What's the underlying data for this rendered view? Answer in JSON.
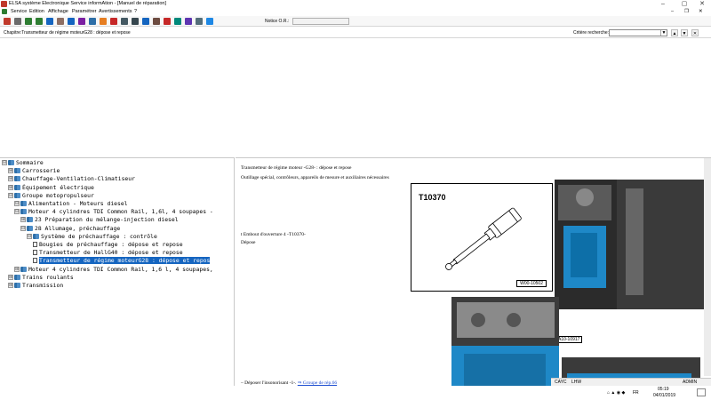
{
  "window": {
    "title": "ELSA système Electronique Service informAtion - [Manuel de réparation]",
    "minimize": "–",
    "maximize": "▢",
    "close": "✕"
  },
  "menu": {
    "items": [
      "Service",
      "Edition",
      "Affichage",
      "Paramétrer",
      "Avertissements",
      "?"
    ],
    "doc_minimize": "–",
    "doc_maximize": "❐",
    "doc_close": "✕"
  },
  "toolbar": {
    "notice_label": "Notice O.R.:",
    "notice_value": "",
    "icons": [
      "open-icon",
      "print-icon",
      "back-icon",
      "forward-icon",
      "tree-icon",
      "history-icon",
      "info-icon",
      "home-icon",
      "book-icon",
      "wiring-icon",
      "stop-icon",
      "tool-icon",
      "battery-icon",
      "save-icon",
      "catalog-icon",
      "car-icon",
      "note-icon",
      "mail-icon",
      "zoom-icon",
      "help-icon"
    ],
    "colors": {
      "open-icon": "#c0392b",
      "print-icon": "#6b6b6b",
      "back-icon": "#2e7d32",
      "forward-icon": "#2e7d32",
      "tree-icon": "#1565c0",
      "history-icon": "#8d6e63",
      "info-icon": "#1565c0",
      "home-icon": "#7b1fa2",
      "book-icon": "#2e6fa8",
      "wiring-icon": "#e67e22",
      "stop-icon": "#c62828",
      "tool-icon": "#455a64",
      "battery-icon": "#37474f",
      "save-icon": "#1565c0",
      "catalog-icon": "#6d4c41",
      "car-icon": "#c62828",
      "note-icon": "#00897b",
      "mail-icon": "#5e35b1",
      "zoom-icon": "#546e7a",
      "help-icon": "#1e88e5"
    }
  },
  "chapter_bar": {
    "chapter": "Chapitre:Transmetteur de régime moteurG28 : dépose et repose",
    "critere_label": "Critère recherche:",
    "critere_value": "",
    "dropdown_arrow": "▼",
    "btn_up": "▲",
    "btn_down": "▼",
    "btn_x": "✕"
  },
  "tree": {
    "nodes": [
      {
        "exp": "⊟",
        "icon": "book",
        "label": "Sommaire"
      },
      {
        "exp": "⊞",
        "icon": "book",
        "label": "Carrosserie"
      },
      {
        "exp": "⊞",
        "icon": "book",
        "label": "Chauffage-Ventilation-Climatiseur"
      },
      {
        "exp": "⊞",
        "icon": "book",
        "label": "Équipement électrique"
      },
      {
        "exp": "⊟",
        "icon": "book",
        "label": "Groupe motopropulseur"
      },
      {
        "exp": "⊟",
        "icon": "book",
        "label": "Alimentation - Moteurs diesel"
      },
      {
        "exp": "⊟",
        "icon": "book",
        "label": "Moteur 4 cylindres TDI Common Rail, 1,6l, 4 soupapes -"
      },
      {
        "exp": "⊞",
        "icon": "book",
        "label": "23 Préparation du mélange-injection diesel"
      },
      {
        "exp": "⊟",
        "icon": "book",
        "label": "28 Allumage, préchauffage"
      },
      {
        "exp": "⊟",
        "icon": "book",
        "label": "Système de préchauffage : contrôle"
      },
      {
        "exp": "",
        "icon": "page",
        "label": "Bougies de préchauffage : dépose et repose"
      },
      {
        "exp": "",
        "icon": "page",
        "label": "Transmetteur de HallG40 : dépose et repose"
      },
      {
        "exp": "",
        "icon": "page",
        "label": "Transmetteur de régime moteurG28 : dépose et repos",
        "selected": true
      },
      {
        "exp": "⊞",
        "icon": "book",
        "label": "Moteur 4 cylindres TDI Common Rail, 1,6 l, 4 soupapes,"
      },
      {
        "exp": "⊞",
        "icon": "book",
        "label": "Trains roulants"
      },
      {
        "exp": "⊞",
        "icon": "book",
        "label": "Transmission"
      }
    ]
  },
  "content": {
    "heading": "Transmetteur de régime moteur -G28- : dépose et repose",
    "tools_intro": "Outillage spécial, contrôleurs, appareils de mesure et auxiliaires nécessaires",
    "tool_item": "t  Embout d'ouverture 4 -T10370-",
    "depose": "Dépose",
    "tool_number": "T10370",
    "tool_ref": "W00-10502",
    "photo_ref": "A10-10917",
    "step_prefix": "–  Déposer l'insonorisant -1-.",
    "step_link": "⇒ Groupe de rép.66"
  },
  "status_bar": {
    "caps": "CAYC",
    "lhw": "LHW",
    "user": "ADMIN"
  },
  "taskbar": {
    "time": "05:19",
    "date": "04/01/2019",
    "lang": "FR"
  }
}
